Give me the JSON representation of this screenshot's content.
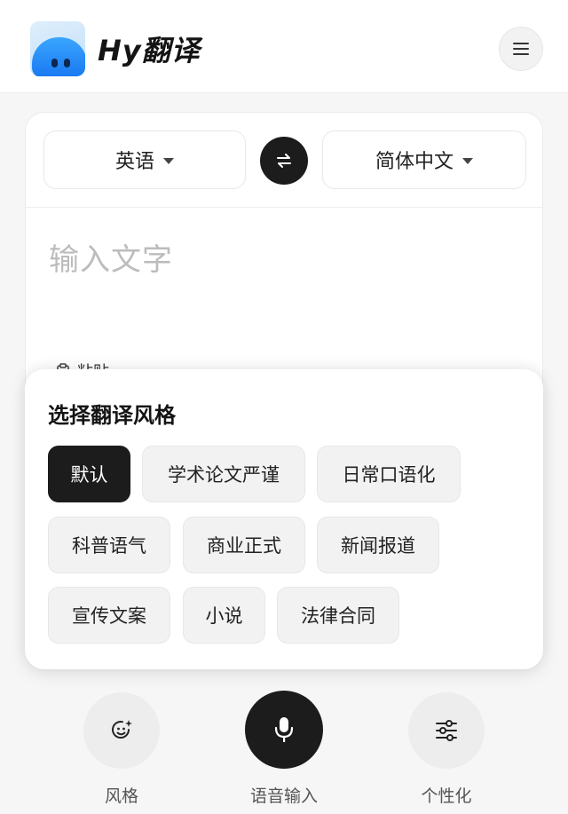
{
  "header": {
    "app_title": "Hy翻译",
    "logo_icon": "hy-mascot-logo",
    "menu_icon": "hamburger-menu-icon"
  },
  "translator": {
    "source_language": "英语",
    "target_language": "简体中文",
    "swap_icon": "swap-arrows-icon",
    "input_placeholder": "输入文字",
    "paste_label": "粘贴",
    "paste_icon": "clipboard-icon"
  },
  "style_panel": {
    "title": "选择翻译风格",
    "selected": "默认",
    "options": [
      "默认",
      "学术论文严谨",
      "日常口语化",
      "科普语气",
      "商业正式",
      "新闻报道",
      "宣传文案",
      "小说",
      "法律合同"
    ]
  },
  "bottom_bar": {
    "style_label": "风格",
    "style_icon": "sparkle-face-icon",
    "voice_label": "语音输入",
    "voice_icon": "microphone-icon",
    "personalize_label": "个性化",
    "personalize_icon": "sliders-icon"
  },
  "colors": {
    "accent_dark": "#1c1c1c",
    "background": "#f6f6f6",
    "placeholder": "#bcbcbc",
    "logo_blue": "#1978f0"
  }
}
